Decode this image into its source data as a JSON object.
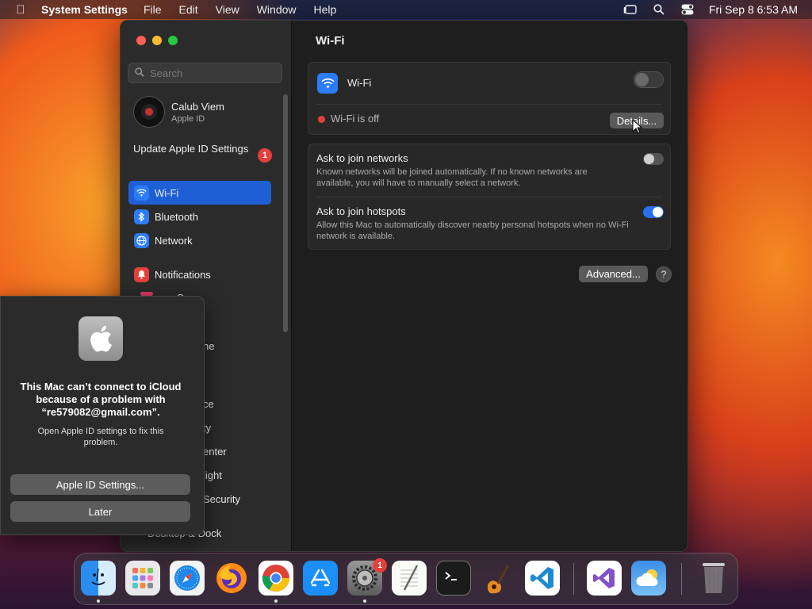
{
  "menubar": {
    "app_name": "System Settings",
    "menus": [
      "File",
      "Edit",
      "View",
      "Window",
      "Help"
    ],
    "clock": "Fri Sep 8  6:53 AM"
  },
  "sidebar": {
    "search_placeholder": "Search",
    "account": {
      "name": "Calub Viem",
      "subtitle": "Apple ID"
    },
    "update": {
      "label": "Update Apple ID Settings",
      "badge": "1"
    },
    "items": [
      {
        "label": "Wi-Fi",
        "icon": "wifi-icon",
        "active": true
      },
      {
        "label": "Bluetooth",
        "icon": "bluetooth-icon"
      },
      {
        "label": "Network",
        "icon": "globe-icon"
      },
      {
        "label": "Notifications",
        "icon": "bell-icon"
      }
    ],
    "partial_items": [
      "S",
      "ne",
      "ce",
      "ty",
      "enter",
      "light",
      "Security",
      "Desktop & Dock"
    ]
  },
  "content": {
    "title": "Wi-Fi",
    "wifi": {
      "label": "Wi-Fi",
      "status": "Wi-Fi is off",
      "details_button": "Details...",
      "enabled": false
    },
    "ask_networks": {
      "title": "Ask to join networks",
      "desc": "Known networks will be joined automatically. If no known networks are available, you will have to manually select a network.",
      "enabled": false
    },
    "ask_hotspots": {
      "title": "Ask to join hotspots",
      "desc": "Allow this Mac to automatically discover nearby personal hotspots when no Wi-Fi network is available.",
      "enabled": true
    },
    "advanced_button": "Advanced...",
    "help_button": "?"
  },
  "dialog": {
    "title": "This Mac can’t connect to iCloud because of a problem with “re579082@gmail.com”.",
    "message": "Open Apple ID settings to fix this problem.",
    "primary_button": "Apple ID Settings...",
    "secondary_button": "Later"
  },
  "dock": {
    "apps": [
      "Finder",
      "Launchpad",
      "Safari",
      "Firefox",
      "Chrome",
      "App Store",
      "System Settings",
      "TextEdit",
      "Terminal",
      "GarageBand",
      "Visual Studio Code",
      "Visual Studio",
      "Weather",
      "Trash"
    ],
    "settings_badge": "1"
  },
  "colors": {
    "accent": "#1f5fd6",
    "toggle_on": "#2a6ef0",
    "status_off": "#e5403b"
  }
}
